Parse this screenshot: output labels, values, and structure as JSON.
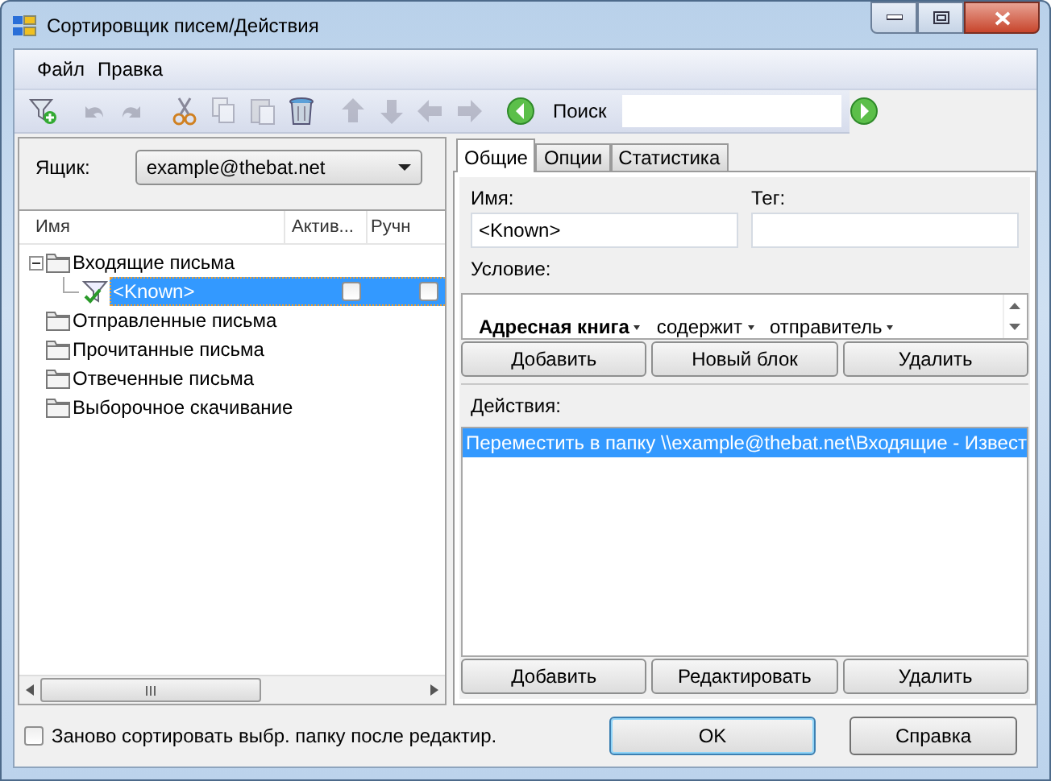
{
  "window": {
    "title": "Сортировщик писем/Действия"
  },
  "menu": [
    {
      "label": "Файл"
    },
    {
      "label": "Правка"
    }
  ],
  "toolbar": {
    "buttons": [
      {
        "kind": "new-filter",
        "disabled": false
      },
      {
        "kind": "sep"
      },
      {
        "kind": "undo",
        "disabled": true
      },
      {
        "kind": "redo",
        "disabled": true
      },
      {
        "kind": "sep"
      },
      {
        "kind": "cut",
        "disabled": false
      },
      {
        "kind": "copy",
        "disabled": true
      },
      {
        "kind": "paste",
        "disabled": true
      },
      {
        "kind": "delete",
        "disabled": false
      },
      {
        "kind": "sep"
      },
      {
        "kind": "up",
        "disabled": true
      },
      {
        "kind": "down",
        "disabled": true
      },
      {
        "kind": "left",
        "disabled": true
      },
      {
        "kind": "right",
        "disabled": true
      },
      {
        "kind": "sep"
      },
      {
        "kind": "prev",
        "disabled": false
      }
    ],
    "search": {
      "label": "Поиск"
    }
  },
  "mailbox": {
    "label": "Ящик:",
    "value": "example@thebat.net"
  },
  "tree": {
    "columns": [
      "Имя",
      "Актив...",
      "Ручн"
    ],
    "items": [
      {
        "label": "Входящие письма",
        "expanded": true,
        "children": [
          {
            "label": "<Known>",
            "selected": true,
            "active": false,
            "manual": false
          }
        ]
      },
      {
        "label": "Отправленные письма"
      },
      {
        "label": "Прочитанные письма"
      },
      {
        "label": "Отвеченные письма"
      },
      {
        "label": "Выборочное скачивание"
      }
    ]
  },
  "tabs": [
    {
      "label": "Общие",
      "selected": true
    },
    {
      "label": "Опции",
      "selected": false
    },
    {
      "label": "Статистика",
      "selected": false
    }
  ],
  "name_field": {
    "label": "Имя:",
    "value": "<Known>"
  },
  "tag_field": {
    "label": "Тег:"
  },
  "condition": {
    "label": "Условие:",
    "field": "Адресная книга",
    "operator": "содержит",
    "target": "отправитель"
  },
  "condition_buttons": [
    "Добавить",
    "Новый блок",
    "Удалить"
  ],
  "actions": {
    "label": "Действия:",
    "items": [
      {
        "text": "Переместить в папку \\\\example@thebat.net\\Входящие - Извест",
        "selected": true
      }
    ]
  },
  "action_buttons": [
    "Добавить",
    "Редактировать",
    "Удалить"
  ],
  "resort": {
    "label": "Заново сортировать выбр. папку после редактир.",
    "checked": false
  },
  "dialog_buttons": [
    {
      "label": "OK",
      "default": true
    },
    {
      "label": "Справка",
      "default": false
    }
  ]
}
